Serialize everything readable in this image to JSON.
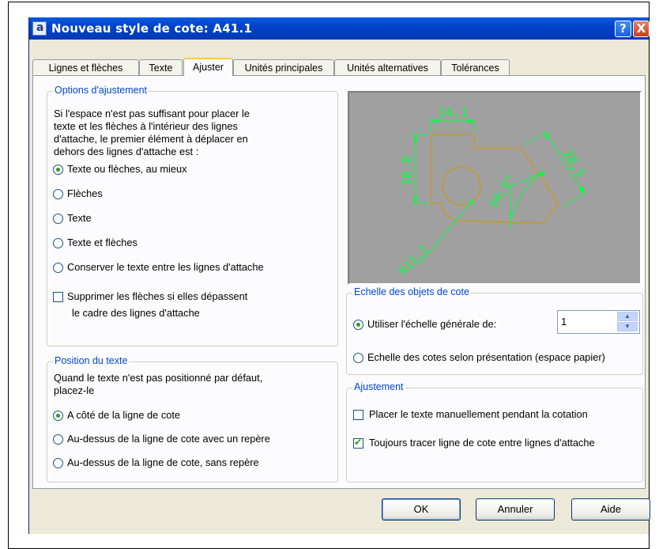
{
  "window": {
    "title": "Nouveau style de cote: A41.1",
    "help_label": "?",
    "close_label": "X"
  },
  "tabs": [
    {
      "label": "Lignes et flèches"
    },
    {
      "label": "Texte"
    },
    {
      "label": "Ajuster"
    },
    {
      "label": "Unités principales"
    },
    {
      "label": "Unités alternatives"
    },
    {
      "label": "Tolérances"
    }
  ],
  "fit_options": {
    "legend": "Options d'ajustement",
    "desc_lines": [
      "Si l'espace n'est pas suffisant pour placer le",
      "texte et les flèches à l'intérieur des lignes",
      "d'attache, le premier élément à déplacer en",
      "dehors des lignes d'attache est :"
    ],
    "radios": [
      {
        "label": "Texte ou flèches, au mieux",
        "checked": true
      },
      {
        "label": "Flèches",
        "checked": false
      },
      {
        "label": "Texte",
        "checked": false
      },
      {
        "label": "Texte et flèches",
        "checked": false
      },
      {
        "label": "Conserver le texte entre les lignes d'attache",
        "checked": false
      }
    ],
    "suppress_check": {
      "line1": "Supprimer les flèches si elles dépassent",
      "line2": "le cadre des lignes d'attache",
      "checked": false
    }
  },
  "text_position": {
    "legend": "Position du texte",
    "desc_lines": [
      "Quand le texte n'est pas positionné par défaut,",
      "placez-le"
    ],
    "radios": [
      {
        "label": "A côté de la ligne de cote",
        "checked": true
      },
      {
        "label": "Au-dessus de la ligne de cote avec un repère",
        "checked": false
      },
      {
        "label": "Au-dessus de la ligne de cote, sans repère",
        "checked": false
      }
    ]
  },
  "preview": {
    "dim_top": "14,1",
    "dim_left": "16,6",
    "dim_right": "28,1",
    "dim_angle": "60,0°",
    "dim_radius": "R11,2"
  },
  "scale": {
    "legend": "Echelle des objets de cote",
    "radio_overall": {
      "label": "Utiliser l'échelle générale de:",
      "checked": true
    },
    "overall_value": "1",
    "radio_layout": {
      "label": "Echelle des cotes selon présentation (espace papier)",
      "checked": false
    }
  },
  "fine_tuning": {
    "legend": "Ajustement",
    "manual_check": {
      "label": "Placer le texte manuellement pendant la cotation",
      "checked": false
    },
    "always_check": {
      "label": "Toujours tracer ligne de cote entre lignes d'attache",
      "checked": true
    }
  },
  "buttons": {
    "ok": "OK",
    "cancel": "Annuler",
    "help": "Aide"
  },
  "colors": {
    "titlebar": "#0a5adf",
    "legend_text": "#0046d5",
    "preview_bg": "#a0a0a0",
    "geometry": "#c8961e",
    "dimension": "#00ff3c"
  }
}
